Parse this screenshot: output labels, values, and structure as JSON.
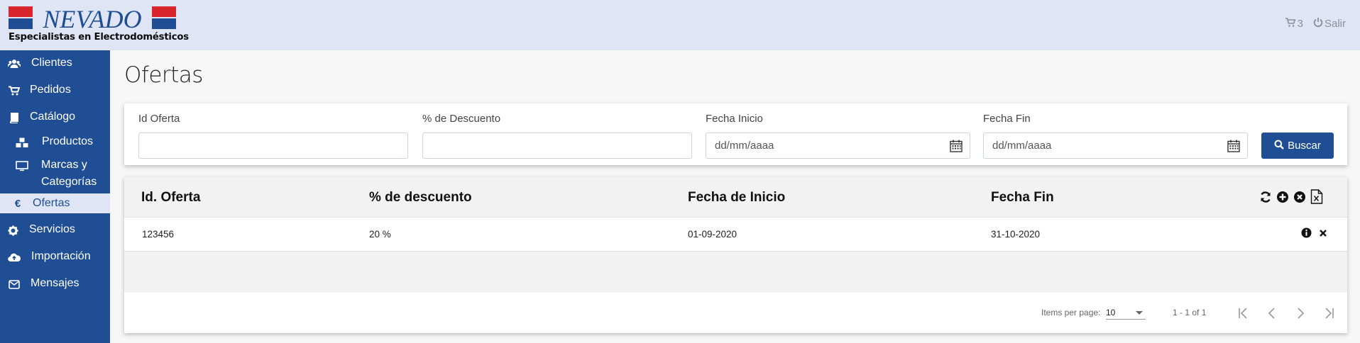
{
  "header": {
    "logo_text": "NEVADO",
    "logo_tagline": "Especialistas en Electrodomésticos",
    "cart_count": "3",
    "logout_label": "Salir"
  },
  "sidebar": {
    "items": [
      {
        "label": "Clientes",
        "icon": "users-icon"
      },
      {
        "label": "Pedidos",
        "icon": "cart-icon"
      },
      {
        "label": "Catálogo",
        "icon": "book-icon"
      },
      {
        "label": "Productos",
        "icon": "cubes-icon"
      },
      {
        "label": "Marcas y",
        "label2": "Categorías",
        "icon": "desktop-icon"
      },
      {
        "label": "Ofertas",
        "icon": "euro-icon",
        "active": true
      },
      {
        "label": "Servicios",
        "icon": "gear-icon"
      },
      {
        "label": "Importación",
        "icon": "cloud-upload-icon"
      },
      {
        "label": "Mensajes",
        "icon": "envelope-icon"
      }
    ]
  },
  "page": {
    "title": "Ofertas"
  },
  "filters": {
    "id_label": "Id Oferta",
    "id_value": "",
    "descuento_label": "% de Descuento",
    "descuento_value": "",
    "fecha_inicio_label": "Fecha Inicio",
    "fecha_inicio_placeholder": "dd/mm/aaaa",
    "fecha_fin_label": "Fecha Fin",
    "fecha_fin_placeholder": "dd/mm/aaaa",
    "buscar_label": "Buscar"
  },
  "table": {
    "columns": [
      "Id. Oferta",
      "% de descuento",
      "Fecha de Inicio",
      "Fecha Fin"
    ],
    "rows": [
      [
        "123456",
        "20 %",
        "01-09-2020",
        "31-10-2020"
      ]
    ]
  },
  "paginator": {
    "items_per_page_label": "Items per page:",
    "items_per_page_value": "10",
    "range_label": "1 - 1 of 1"
  },
  "colors": {
    "primary": "#1f4e95",
    "header_bg": "#dfe5f5",
    "logo_red": "#d9252e",
    "logo_blue": "#1f4e95"
  }
}
